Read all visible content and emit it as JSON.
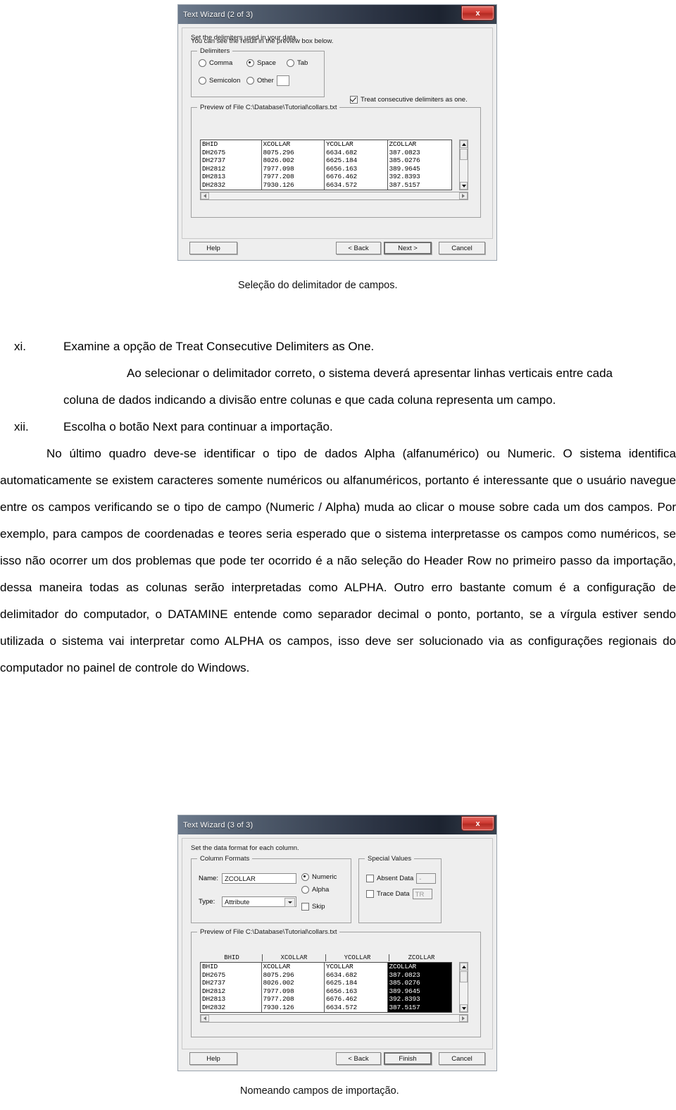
{
  "dialog1": {
    "title": "Text Wizard (2 of 3)",
    "close_label": "x",
    "instruction_line1": "Set the delimiters used in your data.",
    "instruction_line2": "You can see the result in the preview box below.",
    "delimiters_group_label": "Delimiters",
    "options": [
      {
        "label": "Comma",
        "selected": false
      },
      {
        "label": "Space",
        "selected": true
      },
      {
        "label": "Tab",
        "selected": false
      },
      {
        "label": "Semicolon",
        "selected": false
      },
      {
        "label": "Other",
        "selected": false
      }
    ],
    "other_value": "",
    "treat_consecutive_label": "Treat consecutive delimiters as one.",
    "treat_consecutive_checked": true,
    "preview_group_label": "Preview of File C:\\Database\\Tutorial\\collars.txt",
    "buttons": {
      "help": "Help",
      "back": "< Back",
      "next": "Next >",
      "cancel": "Cancel"
    }
  },
  "dialog2": {
    "title": "Text Wizard (3 of 3)",
    "close_label": "x",
    "instruction_line1": "Set the data format for each column.",
    "column_formats_group_label": "Column Formats",
    "name_label": "Name:",
    "name_value": "ZCOLLAR",
    "type_label": "Type:",
    "type_value": "Attribute",
    "format_options": [
      {
        "label": "Numeric",
        "selected": true
      },
      {
        "label": "Alpha",
        "selected": false
      }
    ],
    "skip_label": "Skip",
    "skip_checked": false,
    "special_values_group_label": "Special Values",
    "absent_data_label": "Absent Data",
    "absent_data_value": "-",
    "absent_data_checked": false,
    "trace_data_label": "Trace Data",
    "trace_data_value": "TR",
    "trace_data_checked": false,
    "preview_group_label": "Preview of File C:\\Database\\Tutorial\\collars.txt",
    "preview_column_headers": [
      "BHID",
      "XCOLLAR",
      "YCOLLAR",
      "ZCOLLAR"
    ],
    "selected_column_index": 3,
    "buttons": {
      "help": "Help",
      "back": "< Back",
      "finish": "Finish",
      "cancel": "Cancel"
    }
  },
  "preview_table": {
    "columns": [
      "BHID",
      "XCOLLAR",
      "YCOLLAR",
      "ZCOLLAR"
    ],
    "rows": [
      [
        "DH2675",
        "8075.296",
        "6634.682",
        "387.0823"
      ],
      [
        "DH2737",
        "8026.002",
        "6625.184",
        "385.0276"
      ],
      [
        "DH2812",
        "7977.098",
        "6656.163",
        "389.9645"
      ],
      [
        "DH2813",
        "7977.208",
        "6676.462",
        "392.8393"
      ],
      [
        "DH2832",
        "7930.126",
        "6634.572",
        "387.5157"
      ]
    ]
  },
  "captions": {
    "figure1": "Seleção do delimitador de campos.",
    "figure2": "Nomeando campos de importação."
  },
  "content": {
    "item_xi_marker": "xi.",
    "item_xi_text": "Examine a opção de Treat Consecutive Delimiters as One.",
    "para_xi": "Ao selecionar o delimitador correto, o sistema deverá apresentar linhas verticais entre cada coluna de dados indicando a divisão entre colunas e que cada coluna representa um campo.",
    "item_xii_marker": "xii.",
    "item_xii_text": "Escolha o botão Next para continuar a importação.",
    "para_final": "No último quadro deve-se identificar o tipo de dados Alpha (alfanumérico) ou Numeric. O sistema identifica automaticamente se existem caracteres somente numéricos ou alfanuméricos, portanto é interessante que o usuário navegue entre os campos verificando se o tipo de campo (Numeric / Alpha) muda ao clicar o mouse sobre cada um dos campos. Por exemplo, para campos de coordenadas e teores seria esperado que o sistema interpretasse os campos como numéricos, se isso não ocorrer um dos problemas que pode ter ocorrido é a não seleção do Header Row no primeiro passo da importação, dessa maneira todas as colunas serão interpretadas como ALPHA. Outro erro bastante comum é a configuração de delimitador do computador, o DATAMINE entende como separador decimal o ponto, portanto, se a vírgula estiver sendo utilizada o sistema vai interpretar como ALPHA os campos, isso deve ser solucionado via as configurações regionais do computador no painel de controle do Windows."
  }
}
